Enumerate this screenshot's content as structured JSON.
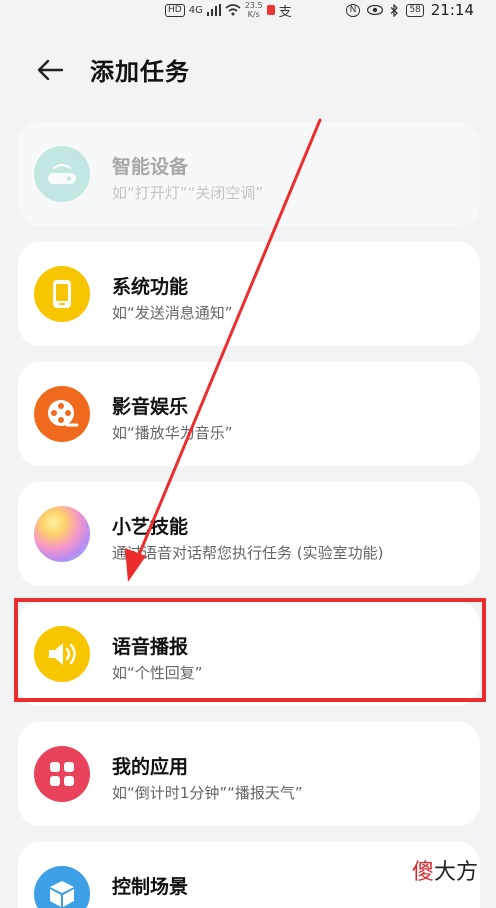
{
  "status": {
    "hd": "HD",
    "signal": "4G",
    "net_speed_value": "23.5",
    "net_speed_unit": "K/s",
    "nfc": "N",
    "battery": "58",
    "time": "21:14"
  },
  "header": {
    "title": "添加任务"
  },
  "cards": [
    {
      "title": "智能设备",
      "subtitle": "如“打开灯”“关闭空调”",
      "icon": "smart-device-icon",
      "color": "#62c7b8",
      "disabled": true
    },
    {
      "title": "系统功能",
      "subtitle": "如“发送消息通知”",
      "icon": "phone-icon",
      "color": "#f7c600"
    },
    {
      "title": "影音娱乐",
      "subtitle": "如“播放华为音乐”",
      "icon": "film-reel-icon",
      "color": "#f06a1e"
    },
    {
      "title": "小艺技能",
      "subtitle": "通过语音对话帮您执行任务 (实验室功能)",
      "icon": "xiaoyi-orb-icon",
      "color": "#f08ad0"
    },
    {
      "title": "语音播报",
      "subtitle": "如“个性回复”",
      "icon": "speaker-icon",
      "color": "#f7c600"
    },
    {
      "title": "我的应用",
      "subtitle": "如“倒计时1分钟”“播报天气”",
      "icon": "apps-grid-icon",
      "color": "#e8435b"
    },
    {
      "title": "控制场景",
      "subtitle": "",
      "icon": "cube-icon",
      "color": "#3da0e6"
    }
  ],
  "watermark": {
    "part1": "傻",
    "part2": "大方"
  }
}
